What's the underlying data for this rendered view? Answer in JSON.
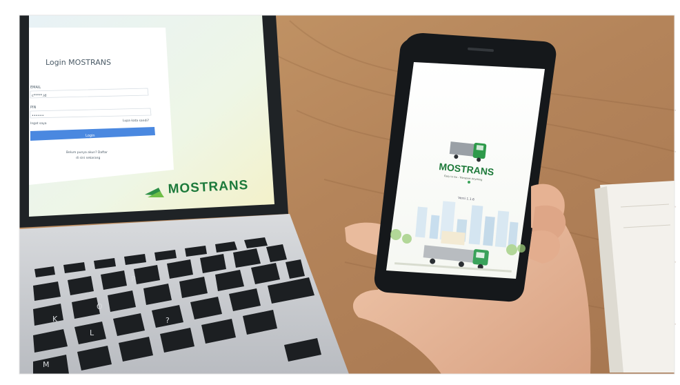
{
  "laptop_login": {
    "title": "Login MOSTRANS",
    "email_label": "EMAIL",
    "email_value": "c*****.id",
    "password_label": "PIN",
    "password_value": "••••••",
    "remember_label": "Ingat saya",
    "forgot_link": "Lupa kata sandi?",
    "login_button": "Login",
    "register_line1": "Belum punya akun? Daftar",
    "register_line2": "di sini sekarang"
  },
  "laptop_brand": {
    "name": "MOSTRANS"
  },
  "phone_splash": {
    "brand": "MOSTRANS",
    "tagline": "Easy to Go - Transport Anything",
    "version": "Versi 1.1.6"
  },
  "colors": {
    "brand_green": "#1d7a3b",
    "login_button_blue": "#4a88e0",
    "wood": "#b98a5b",
    "laptop_body": "#c9cbcf"
  }
}
